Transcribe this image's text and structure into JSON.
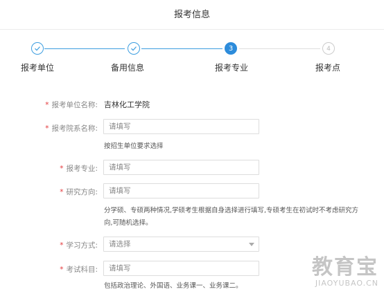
{
  "header": {
    "title": "报考信息"
  },
  "steps": [
    {
      "number": "",
      "label": "报考单位",
      "state": "done"
    },
    {
      "number": "",
      "label": "备用信息",
      "state": "done"
    },
    {
      "number": "3",
      "label": "报考专业",
      "state": "active"
    },
    {
      "number": "4",
      "label": "报考点",
      "state": "todo"
    }
  ],
  "form": {
    "unit_name": {
      "label": "报考单位名称:",
      "value": "吉林化工学院"
    },
    "department": {
      "label": "报考院系名称:",
      "placeholder": "请填写",
      "hint": "按招生单位要求选择"
    },
    "major": {
      "label": "报考专业:",
      "placeholder": "请填写"
    },
    "research": {
      "label": "研究方向:",
      "placeholder": "请填写",
      "hint_line1": "分学硕、专硕两种情况,学硕考生根据自身选择进行填写,专硕考生在初试时不考虑研究方",
      "hint_line2": "向,可随机选择。"
    },
    "study_mode": {
      "label": "学习方式:",
      "placeholder": "请选择"
    },
    "exam_subject": {
      "label": "考试科目:",
      "placeholder": "请填写",
      "hint": "包括政治理论、外国语、业务课一、业务课二。"
    }
  },
  "watermark": {
    "main": "教育宝",
    "sub": "JIAOYUBAO.CN"
  },
  "colors": {
    "primary": "#2d8cdb",
    "required": "#e4393c"
  }
}
